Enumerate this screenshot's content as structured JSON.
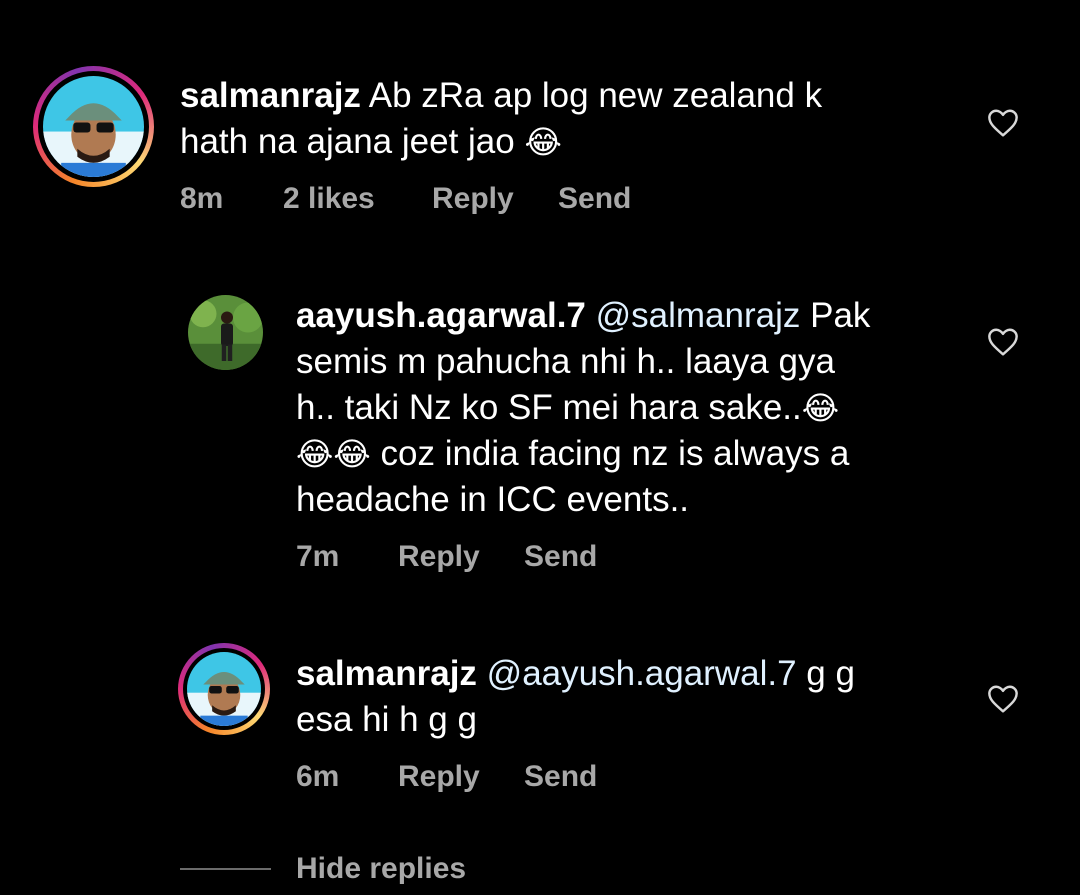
{
  "comments": [
    {
      "username": "salmanrajz",
      "body_1": " Ab zRa ap log new zealand k",
      "body_2": "hath na ajana jeet jao ",
      "emoji": "😂",
      "time": "8m",
      "likes": "2 likes",
      "reply": "Reply",
      "send": "Send"
    },
    {
      "username": "aayush.agarwal.7",
      "mention": "@salmanrajz",
      "body_1": " Pak",
      "body_2": "semis m pahucha nhi h.. laaya gya",
      "body_3": "h.. taki Nz ko SF mei hara sake..",
      "emoji_3": "😂",
      "emoji_4": "😂😂",
      "body_4": " coz india facing nz is always a",
      "body_5": "headache in ICC events..",
      "time": "7m",
      "reply": "Reply",
      "send": "Send"
    },
    {
      "username": "salmanrajz",
      "mention": "@aayush.agarwal.7",
      "body_1": " g g",
      "body_2": "esa hi h g g",
      "time": "6m",
      "reply": "Reply",
      "send": "Send"
    }
  ],
  "hide_replies": "Hide replies",
  "icons": {
    "like": "heart-outline-icon",
    "avatar": "user-avatar"
  },
  "colors": {
    "background": "#000000",
    "meta_text": "#a8a8a8",
    "mention": "#e0f1ff"
  }
}
